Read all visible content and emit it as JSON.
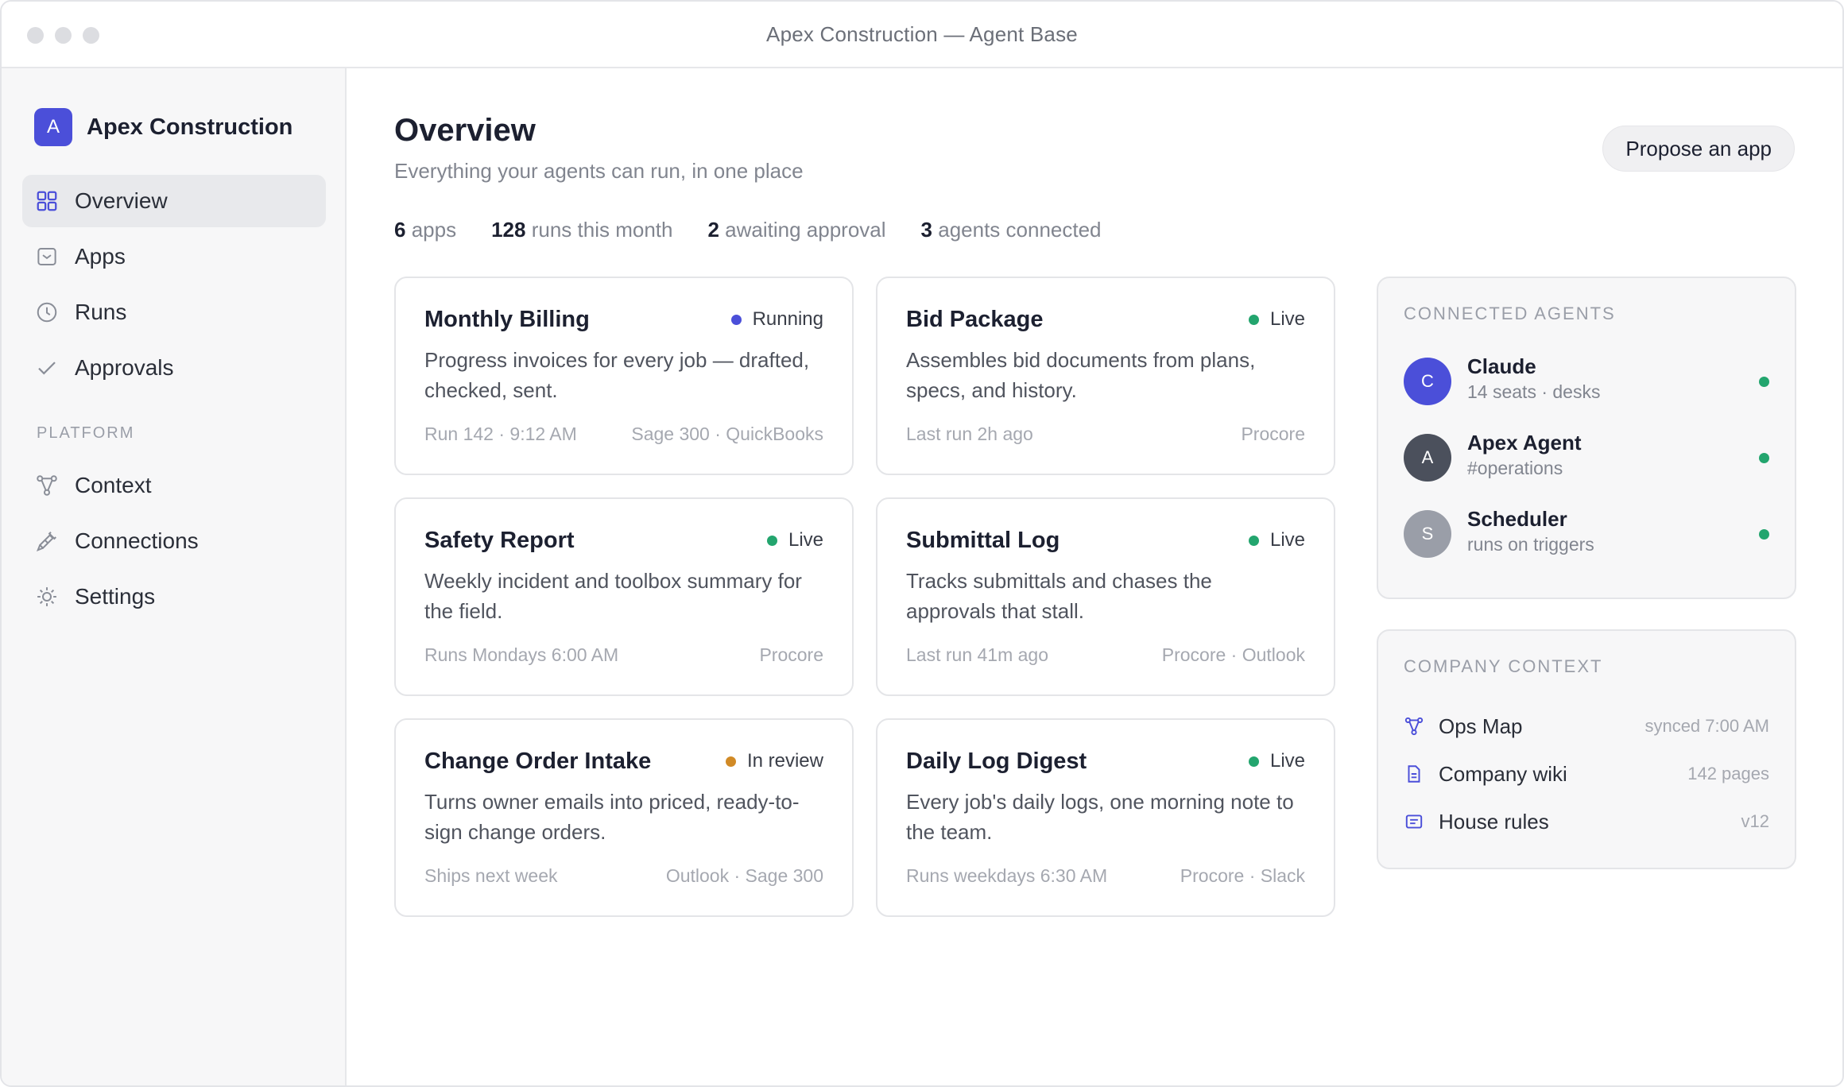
{
  "window": {
    "title": "Apex Construction — Agent Base"
  },
  "sidebar": {
    "brand": {
      "initial": "A",
      "name": "Apex Construction"
    },
    "items": [
      {
        "label": "Overview",
        "icon": "grid-icon",
        "active": true
      },
      {
        "label": "Apps",
        "icon": "inbox-icon",
        "active": false
      },
      {
        "label": "Runs",
        "icon": "clock-icon",
        "active": false
      },
      {
        "label": "Approvals",
        "icon": "check-icon",
        "active": false
      }
    ],
    "platform_label": "PLATFORM",
    "platform_items": [
      {
        "label": "Context",
        "icon": "graph-icon"
      },
      {
        "label": "Connections",
        "icon": "plug-icon"
      },
      {
        "label": "Settings",
        "icon": "sun-gear-icon"
      }
    ]
  },
  "header": {
    "title": "Overview",
    "subtitle": "Everything your agents can run, in one place",
    "propose_label": "Propose an app"
  },
  "stats": [
    {
      "value": "6",
      "label": "apps"
    },
    {
      "value": "128",
      "label": "runs this month"
    },
    {
      "value": "2",
      "label": "awaiting approval"
    },
    {
      "value": "3",
      "label": "agents connected"
    }
  ],
  "apps": [
    {
      "title": "Monthly Billing",
      "status": "Running",
      "status_color": "#4b4fd9",
      "description": "Progress invoices for every job — drafted, checked, sent.",
      "foot_left": "Run 142 · 9:12 AM",
      "foot_right": "Sage 300 · QuickBooks"
    },
    {
      "title": "Bid Package",
      "status": "Live",
      "status_color": "#23a56e",
      "description": "Assembles bid documents from plans, specs, and history.",
      "foot_left": "Last run 2h ago",
      "foot_right": "Procore"
    },
    {
      "title": "Safety Report",
      "status": "Live",
      "status_color": "#23a56e",
      "description": "Weekly incident and toolbox summary for the field.",
      "foot_left": "Runs Mondays 6:00 AM",
      "foot_right": "Procore"
    },
    {
      "title": "Submittal Log",
      "status": "Live",
      "status_color": "#23a56e",
      "description": "Tracks submittals and chases the approvals that stall.",
      "foot_left": "Last run 41m ago",
      "foot_right": "Procore · Outlook"
    },
    {
      "title": "Change Order Intake",
      "status": "In review",
      "status_color": "#d18a26",
      "description": "Turns owner emails into priced, ready-to-sign change orders.",
      "foot_left": "Ships next week",
      "foot_right": "Outlook · Sage 300"
    },
    {
      "title": "Daily Log Digest",
      "status": "Live",
      "status_color": "#23a56e",
      "description": "Every job's daily logs, one morning note to the team.",
      "foot_left": "Runs weekdays 6:30 AM",
      "foot_right": "Procore · Slack"
    }
  ],
  "agents_panel": {
    "label": "CONNECTED AGENTS",
    "agents": [
      {
        "initial": "C",
        "name": "Claude",
        "sub": "14 seats · desks",
        "avatar_color": "#4b4fd9"
      },
      {
        "initial": "A",
        "name": "Apex Agent",
        "sub": "#operations",
        "avatar_color": "#4b505c"
      },
      {
        "initial": "S",
        "name": "Scheduler",
        "sub": "runs on triggers",
        "avatar_color": "#9a9ea8"
      }
    ]
  },
  "context_panel": {
    "label": "COMPANY CONTEXT",
    "items": [
      {
        "name": "Ops Map",
        "meta": "synced 7:00 AM",
        "icon": "graph-icon"
      },
      {
        "name": "Company wiki",
        "meta": "142 pages",
        "icon": "document-icon"
      },
      {
        "name": "House rules",
        "meta": "v12",
        "icon": "note-icon"
      }
    ]
  }
}
